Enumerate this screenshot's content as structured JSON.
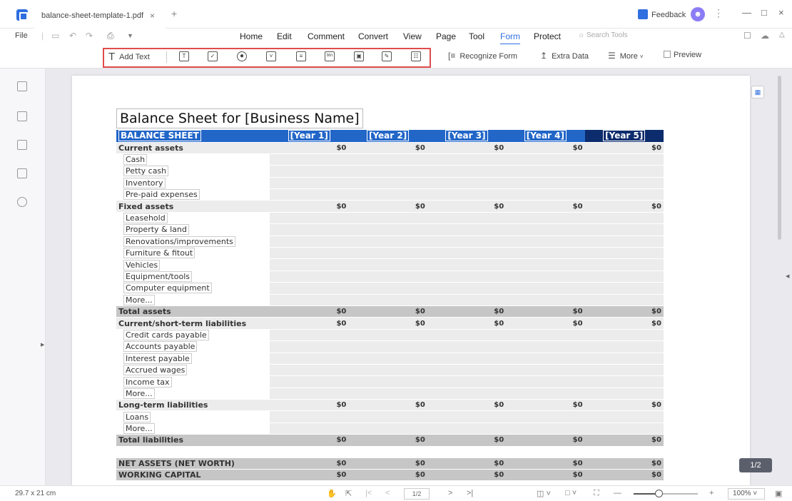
{
  "window": {
    "tab_title": "balance-sheet-template-1.pdf",
    "tab_close": "×",
    "tab_add": "+",
    "feedback": "Feedback",
    "minimize": "—",
    "maximize": "□",
    "close": "×"
  },
  "menu": {
    "file": "File",
    "items": [
      "Home",
      "Edit",
      "Comment",
      "Convert",
      "View",
      "Page",
      "Tool",
      "Form",
      "Protect"
    ],
    "active": "Form",
    "search_placeholder": "Search Tools"
  },
  "ribbon": {
    "add_text": "Add Text",
    "recognize_form": "Recognize Form",
    "extra_data": "Extra Data",
    "more": "More",
    "preview": "Preview",
    "field_tools": [
      "text-field",
      "checkbox",
      "radio-button",
      "combo-box",
      "list-box",
      "button",
      "image-field",
      "signature-field",
      "date-field"
    ]
  },
  "document": {
    "title": "Balance Sheet for [Business Name]",
    "header": {
      "label": "BALANCE SHEET",
      "years": [
        "[Year 1]",
        "[Year 2]",
        "[Year 3]",
        "[Year 4]",
        "[Year 5]"
      ]
    },
    "rows": [
      {
        "type": "section",
        "label": "Current assets",
        "values": [
          "$0",
          "$0",
          "$0",
          "$0",
          "$0"
        ]
      },
      {
        "type": "item",
        "label": "Cash"
      },
      {
        "type": "item",
        "label": "Petty cash"
      },
      {
        "type": "item",
        "label": "Inventory"
      },
      {
        "type": "item",
        "label": "Pre-paid expenses"
      },
      {
        "type": "section",
        "label": "Fixed assets",
        "values": [
          "$0",
          "$0",
          "$0",
          "$0",
          "$0"
        ]
      },
      {
        "type": "item",
        "label": "Leasehold"
      },
      {
        "type": "item",
        "label": "Property & land"
      },
      {
        "type": "item",
        "label": "Renovations/improvements"
      },
      {
        "type": "item",
        "label": "Furniture & fitout"
      },
      {
        "type": "item",
        "label": "Vehicles"
      },
      {
        "type": "item",
        "label": "Equipment/tools"
      },
      {
        "type": "item",
        "label": "Computer equipment"
      },
      {
        "type": "item",
        "label": "More..."
      },
      {
        "type": "total",
        "label": "Total assets",
        "values": [
          "$0",
          "$0",
          "$0",
          "$0",
          "$0"
        ]
      },
      {
        "type": "section",
        "label": "Current/short-term liabilities",
        "values": [
          "$0",
          "$0",
          "$0",
          "$0",
          "$0"
        ]
      },
      {
        "type": "item",
        "label": "Credit cards payable"
      },
      {
        "type": "item",
        "label": "Accounts payable"
      },
      {
        "type": "item",
        "label": "Interest payable"
      },
      {
        "type": "item",
        "label": "Accrued wages"
      },
      {
        "type": "item",
        "label": "Income tax"
      },
      {
        "type": "item",
        "label": "More..."
      },
      {
        "type": "section",
        "label": "Long-term liabilities",
        "values": [
          "$0",
          "$0",
          "$0",
          "$0",
          "$0"
        ]
      },
      {
        "type": "item",
        "label": "Loans"
      },
      {
        "type": "item",
        "label": "More..."
      },
      {
        "type": "total",
        "label": "Total liabilities",
        "values": [
          "$0",
          "$0",
          "$0",
          "$0",
          "$0"
        ]
      },
      {
        "type": "spacer",
        "label": ""
      },
      {
        "type": "total",
        "label": "NET ASSETS (NET WORTH)",
        "values": [
          "$0",
          "$0",
          "$0",
          "$0",
          "$0"
        ]
      },
      {
        "type": "total",
        "label": "WORKING CAPITAL",
        "values": [
          "$0",
          "$0",
          "$0",
          "$0",
          "$0"
        ]
      }
    ]
  },
  "viewer": {
    "page_badge": "1/2",
    "page_size": "29.7 x 21 cm",
    "page_input": "1/2",
    "zoom": "100%",
    "zoom_level_fraction": 0.4
  },
  "colors": {
    "accent": "#2f6fe0",
    "header_blue": "#2266c8",
    "header_dark": "#0c2c6d",
    "highlight_red": "#e04b4b"
  }
}
